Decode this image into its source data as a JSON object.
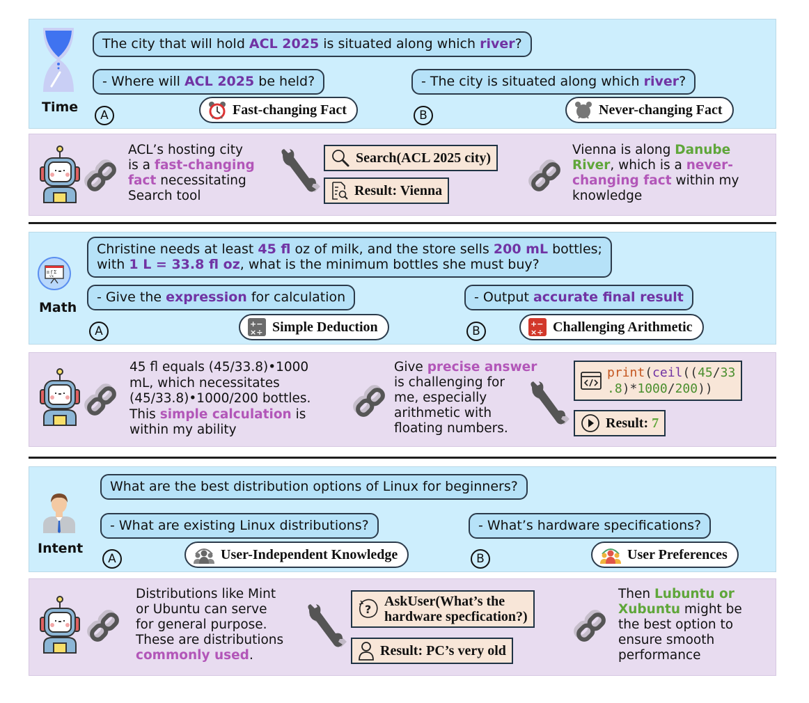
{
  "sections": [
    {
      "category": "Time",
      "question": {
        "parts": [
          "The city that will hold ",
          "ACL 2025",
          " is situated along which ",
          "river",
          "?"
        ]
      },
      "sub_a": {
        "marker": "A",
        "parts": [
          "- Where will ",
          "ACL 2025",
          " be held?"
        ],
        "tag_label": "Fast-changing Fact",
        "tag_icon": "alarm-clock-icon"
      },
      "sub_b": {
        "marker": "B",
        "parts": [
          "- The city is situated along which ",
          "river",
          "?"
        ],
        "tag_label": "Never-changing Fact",
        "tag_icon": "alarm-clock-gray-icon"
      },
      "reasoning_left": {
        "lines": [
          "ACL’s hosting city",
          "is a ",
          "fast-changing",
          "fact",
          " necessitating",
          "Search tool"
        ]
      },
      "tool_call": {
        "icon": "search-icon",
        "label": "Search(ACL 2025 city)"
      },
      "tool_result": {
        "icon": "document-search-icon",
        "label": "Result: Vienna"
      },
      "reasoning_right": {
        "lines": [
          "Vienna is along ",
          "Danube",
          "River",
          ", which is a ",
          "never-",
          "changing fact",
          " within my",
          "knowledge"
        ]
      }
    },
    {
      "category": "Math",
      "question": {
        "parts": [
          "Christine needs at least ",
          "45 fl",
          " oz of milk, and the store sells ",
          "200 mL",
          " bottles;",
          "with ",
          "1 L = 33.8 fl oz",
          ", what is the minimum bottles she must buy?"
        ]
      },
      "sub_a": {
        "marker": "A",
        "parts": [
          "- Give the ",
          "expression",
          " for calculation"
        ],
        "tag_label": "Simple Deduction",
        "tag_icon": "calculator-gray-icon"
      },
      "sub_b": {
        "marker": "B",
        "parts": [
          "- Output ",
          "accurate final result"
        ],
        "tag_label": "Challenging Arithmetic",
        "tag_icon": "calculator-red-icon"
      },
      "reasoning_left": {
        "lines": [
          "45 fl equals (45/33.8)•1000",
          "mL, which necessitates",
          "(45/33.8)•1000/200 bottles.",
          "This ",
          "simple calculation",
          " is",
          "within my ability"
        ]
      },
      "reasoning_mid": {
        "lines": [
          "Give ",
          "precise answer",
          "is challenging for",
          "me, especially",
          "arithmetic with",
          "floating numbers."
        ]
      },
      "tool_call": {
        "icon": "code-icon",
        "code_line1": [
          "print",
          "(",
          "ceil",
          "((",
          "45",
          "/",
          "33"
        ],
        "code_line2": [
          ".8",
          ")*",
          "1000",
          "/",
          "200",
          "))"
        ]
      },
      "tool_result": {
        "icon": "play-icon",
        "label": "Result: ",
        "value": "7"
      }
    },
    {
      "category": "Intent",
      "question": {
        "parts": [
          "What are the best distribution options of Linux for beginners?"
        ]
      },
      "sub_a": {
        "marker": "A",
        "parts": [
          "- What are existing Linux distributions?"
        ],
        "tag_label": "User-Independent Knowledge",
        "tag_icon": "user-group-gray-icon"
      },
      "sub_b": {
        "marker": "B",
        "parts": [
          "- What’s hardware specifications?"
        ],
        "tag_label": "User Preferences",
        "tag_icon": "user-group-color-icon"
      },
      "reasoning_left": {
        "lines": [
          "Distributions like Mint",
          "or Ubuntu can serve",
          "for general purpose.",
          "These are distributions",
          "commonly used",
          "."
        ]
      },
      "tool_call": {
        "icon": "question-bubble-icon",
        "line1": "AskUser(What’s the",
        "line2": "hardware specfication?)"
      },
      "tool_result": {
        "icon": "user-icon",
        "label": "Result: PC’s very old"
      },
      "reasoning_right": {
        "lines": [
          "Then ",
          "Lubuntu or",
          "Xubuntu",
          " might be",
          "the best option to",
          "ensure smooth",
          "performance"
        ]
      }
    }
  ],
  "colors": {
    "question_panel": "#cdeefd",
    "reasoning_panel": "#e8dcf0",
    "bubble": "#b6e2f8",
    "highlight_purple": "#7033a3",
    "highlight_pink": "#b256b8",
    "highlight_green": "#5fa63a",
    "tool_box": "#f8e6d8"
  }
}
